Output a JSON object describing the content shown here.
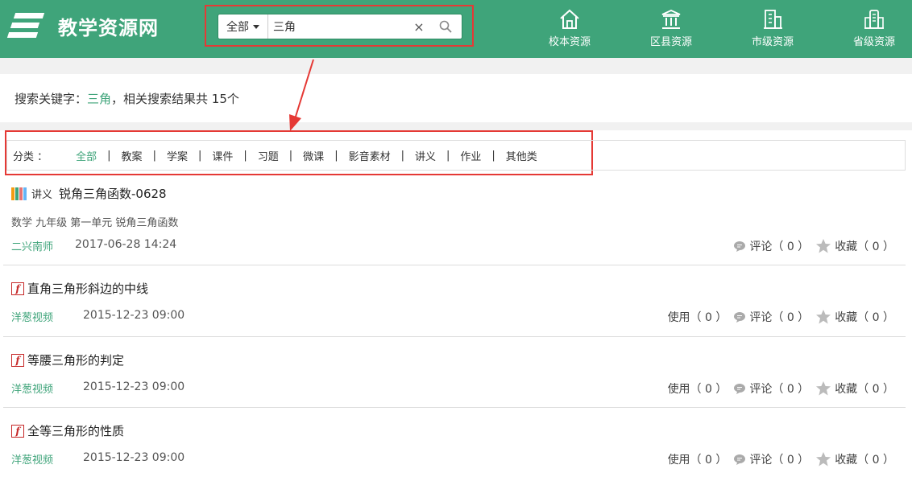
{
  "header": {
    "logo_text": "教学资源网",
    "search": {
      "scope": "全部",
      "query": "三角",
      "clear": "×"
    },
    "nav": [
      {
        "label": "校本资源",
        "icon": "school-icon"
      },
      {
        "label": "区县资源",
        "icon": "government-building-icon"
      },
      {
        "label": "市级资源",
        "icon": "office-building-icon"
      },
      {
        "label": "省级资源",
        "icon": "city-buildings-icon"
      }
    ]
  },
  "keyword": {
    "prefix": "搜索关键字：",
    "term": "三角",
    "suffix": "，相关搜索结果共 15个"
  },
  "categories": {
    "label": "分类 ：",
    "items": [
      "全部",
      "教案",
      "学案",
      "课件",
      "习题",
      "微课",
      "影音素材",
      "讲义",
      "作业",
      "其他类"
    ],
    "active": "全部",
    "separator": "|"
  },
  "results": [
    {
      "type": "讲义",
      "title": "锐角三角函数-0628",
      "subtitle": "数学 九年级 第一单元 锐角三角函数",
      "author": "二兴南师",
      "date": "2017-06-28 14:24",
      "comments": "评论（ 0 ）",
      "favorites": "收藏（ 0 ）"
    },
    {
      "title": "直角三角形斜边的中线",
      "author": "洋葱视频",
      "date": "2015-12-23 09:00",
      "uses": "使用（ 0 ）",
      "comments": "评论（ 0 ）",
      "favorites": "收藏（ 0 ）"
    },
    {
      "title": "等腰三角形的判定",
      "author": "洋葱视频",
      "date": "2015-12-23 09:00",
      "uses": "使用（ 0 ）",
      "comments": "评论（ 0 ）",
      "favorites": "收藏（ 0 ）"
    },
    {
      "title": "全等三角形的性质",
      "author": "洋葱视频",
      "date": "2015-12-23 09:00",
      "uses": "使用（ 0 ）",
      "comments": "评论（ 0 ）",
      "favorites": "收藏（ 0 ）"
    }
  ],
  "colors": {
    "brand": "#3fa47a",
    "highlight": "#e53935"
  }
}
